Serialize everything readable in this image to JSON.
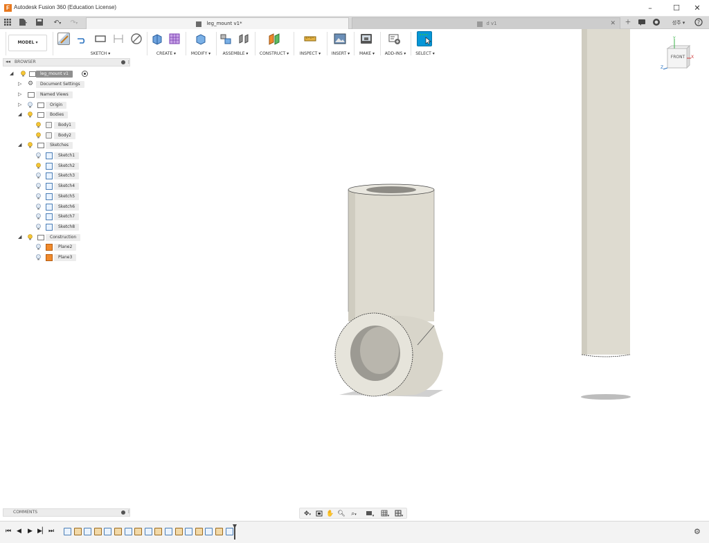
{
  "window": {
    "title": "Autodesk Fusion 360 (Education License)"
  },
  "tabs": [
    {
      "label": "leg_mount v1*",
      "active": true
    },
    {
      "label": "d v1",
      "active": false
    }
  ],
  "toolbar": {
    "workspace": "MODEL ▾",
    "groups": {
      "sketch": "SKETCH ▾",
      "create": "CREATE ▾",
      "modify": "MODIFY ▾",
      "assemble": "ASSEMBLE ▾",
      "construct": "CONSTRUCT ▾",
      "inspect": "INSPECT ▾",
      "insert": "INSERT ▾",
      "make": "MAKE ▾",
      "addins": "ADD-INS ▾",
      "select": "SELECT ▾"
    }
  },
  "right_header": {
    "user": "성주 ▾"
  },
  "browser": {
    "title": "BROWSER",
    "root": "leg_mount v1",
    "document_settings": "Document Settings",
    "named_views": "Named Views",
    "origin": "Origin",
    "bodies": "Bodies",
    "body_items": [
      "Body1",
      "Body2"
    ],
    "sketches": "Sketches",
    "sketch_items": [
      "Sketch1",
      "Sketch2",
      "Sketch3",
      "Sketch4",
      "Sketch5",
      "Sketch6",
      "Sketch7",
      "Sketch8"
    ],
    "construction": "Construction",
    "plane_items": [
      "Plane2",
      "Plane3"
    ]
  },
  "comments": {
    "title": "COMMENTS"
  },
  "viewcube": {
    "face": "FRONT",
    "axis_x": "X",
    "axis_y": "Y",
    "axis_z": "Z"
  },
  "colors": {
    "accent": "#0696d7",
    "plane": "#f08a2c",
    "model": "#dedbd0"
  }
}
